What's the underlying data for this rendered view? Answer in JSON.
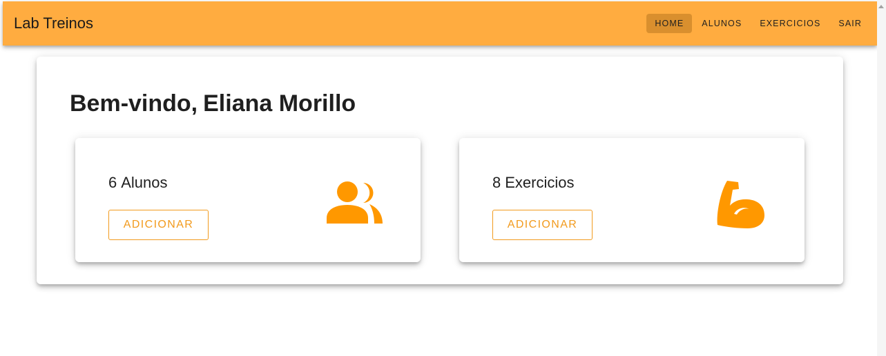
{
  "app": {
    "title": "Lab Treinos"
  },
  "nav": {
    "items": [
      {
        "label": "HOME",
        "active": true
      },
      {
        "label": "ALUNOS",
        "active": false
      },
      {
        "label": "EXERCICIOS",
        "active": false
      },
      {
        "label": "SAIR",
        "active": false
      }
    ]
  },
  "welcome": {
    "greeting": "Bem-vindo,",
    "user_name": "Eliana Morillo"
  },
  "cards": [
    {
      "count": "6",
      "label": "Alunos",
      "button_label": "ADICIONAR",
      "icon": "group-icon"
    },
    {
      "count": "8",
      "label": "Exercicios",
      "button_label": "ADICIONAR",
      "icon": "flexed-bicep-icon"
    }
  ],
  "colors": {
    "appbar": "#ffac40",
    "nav_active": "#d98f2e",
    "accent": "#ff9800",
    "button_text": "#f29a1c"
  }
}
